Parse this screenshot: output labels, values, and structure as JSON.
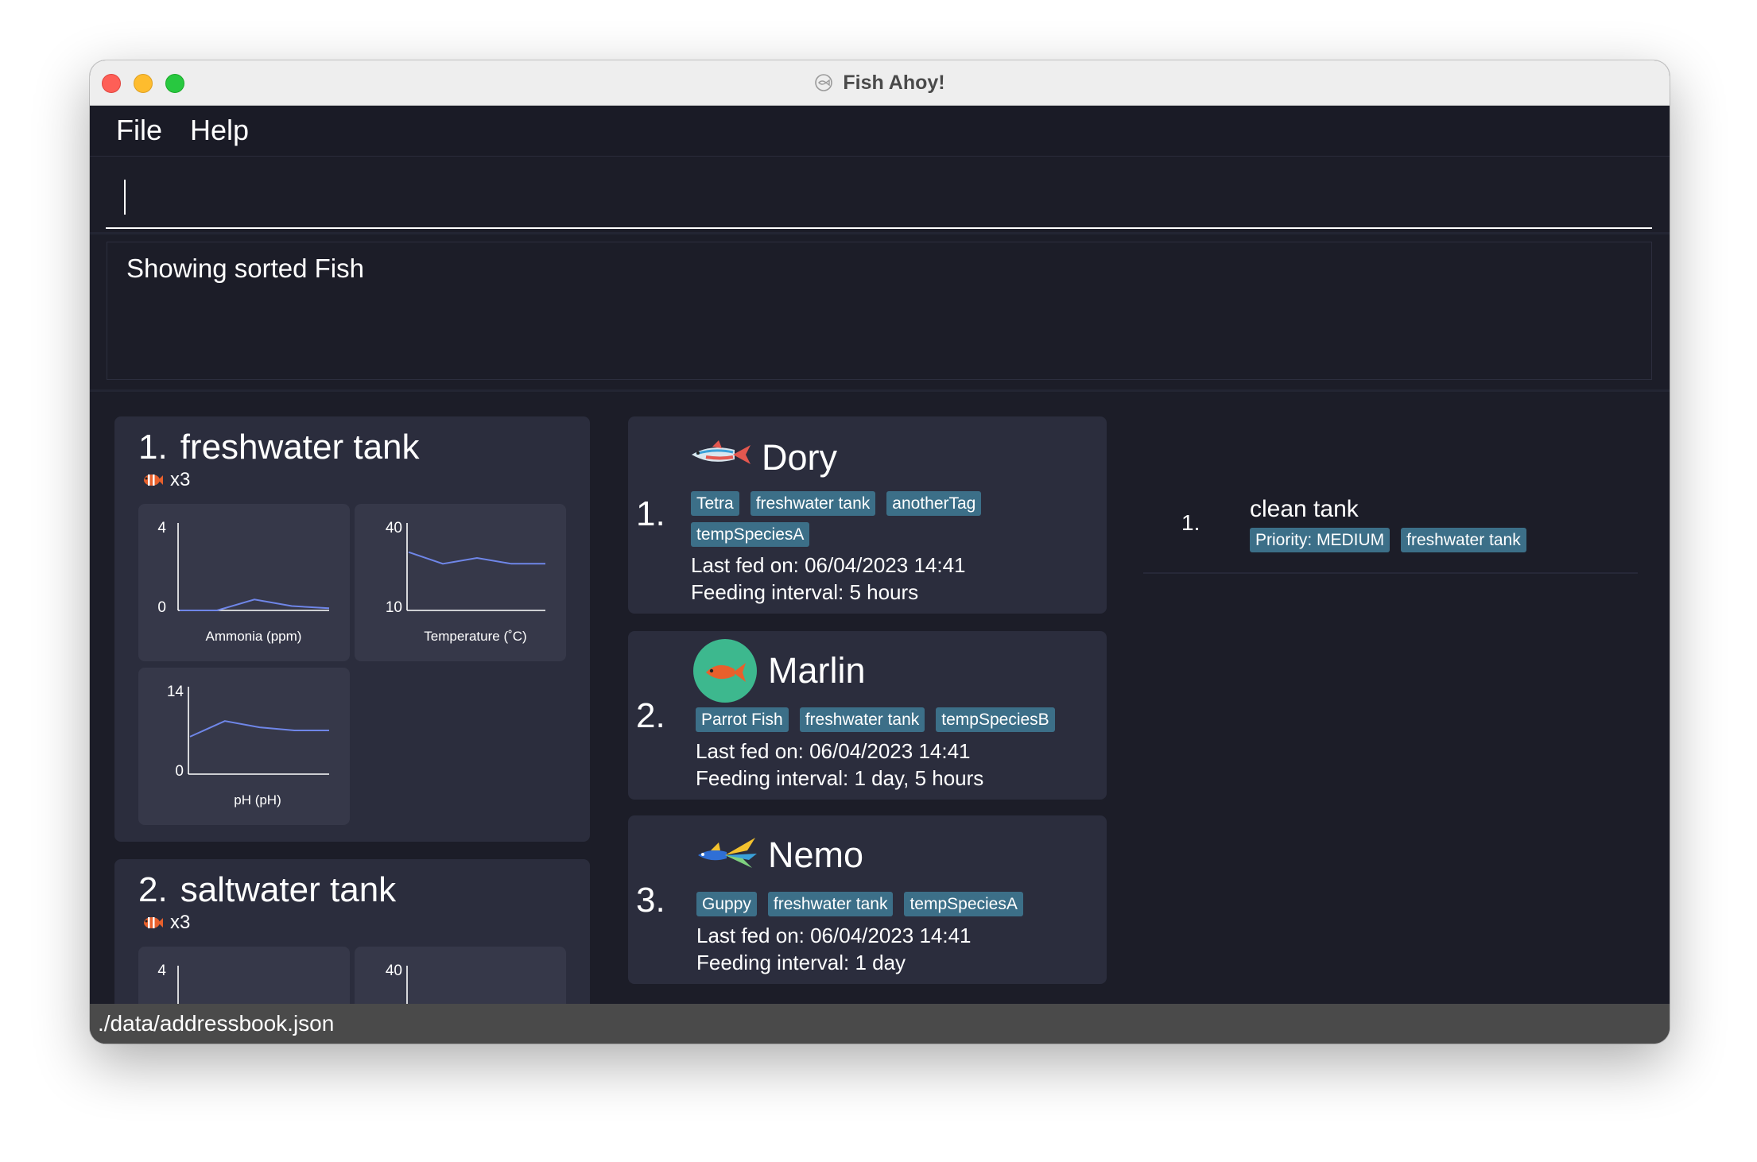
{
  "window": {
    "title": "Fish Ahoy!"
  },
  "menu": {
    "file": "File",
    "help": "Help"
  },
  "command": {
    "value": ""
  },
  "result": {
    "message": "Showing sorted Fish"
  },
  "tanks": [
    {
      "index": "1.",
      "name": "freshwater tank",
      "count": "x3",
      "charts": [
        {
          "label": "Ammonia (ppm)",
          "y_min": "0",
          "y_max": "4",
          "ylim": [
            0,
            4
          ],
          "values": [
            0,
            0,
            0.5,
            0.2,
            0.1
          ]
        },
        {
          "label": "Temperature (˚C)",
          "y_min": "10",
          "y_max": "40",
          "ylim": [
            10,
            40
          ],
          "values": [
            30,
            26,
            28,
            26,
            26
          ]
        },
        {
          "label": "pH (pH)",
          "y_min": "0",
          "y_max": "14",
          "ylim": [
            0,
            14
          ],
          "values": [
            6,
            8.5,
            7.5,
            7,
            7
          ]
        }
      ]
    },
    {
      "index": "2.",
      "name": "saltwater tank",
      "count": "x3",
      "charts": [
        {
          "label": "",
          "y_min": "",
          "y_max": "4"
        },
        {
          "label": "",
          "y_min": "",
          "y_max": "40"
        }
      ]
    }
  ],
  "fish": [
    {
      "index": "1.",
      "name": "Dory",
      "icon": "tetra-fish-icon",
      "tags": [
        "Tetra",
        "freshwater tank",
        "anotherTag",
        "tempSpeciesA"
      ],
      "last_fed": "Last fed on: 06/04/2023 14:41",
      "interval": "Feeding interval: 5 hours"
    },
    {
      "index": "2.",
      "name": "Marlin",
      "icon": "parrot-fish-icon",
      "tags": [
        "Parrot Fish",
        "freshwater tank",
        "tempSpeciesB"
      ],
      "last_fed": "Last fed on: 06/04/2023 14:41",
      "interval": "Feeding interval: 1 day, 5 hours"
    },
    {
      "index": "3.",
      "name": "Nemo",
      "icon": "guppy-fish-icon",
      "tags": [
        "Guppy",
        "freshwater tank",
        "tempSpeciesA"
      ],
      "last_fed": "Last fed on: 06/04/2023 14:41",
      "interval": "Feeding interval: 1 day"
    }
  ],
  "tasks": [
    {
      "index": "1.",
      "name": "clean tank",
      "tags": [
        "Priority: MEDIUM",
        "freshwater tank"
      ]
    }
  ],
  "status": {
    "path": "./data/addressbook.json"
  },
  "colors": {
    "background": "#1c1d28",
    "card": "#2b2d3d",
    "chart_card": "#363849",
    "tag": "#3c6f88",
    "line": "#6f86e8"
  }
}
